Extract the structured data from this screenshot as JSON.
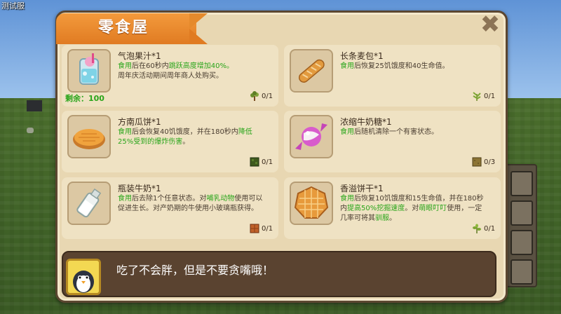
{
  "debug_label": "测试服",
  "title": "零食屋",
  "close_symbol": "✖",
  "items": [
    {
      "name": "气泡果汁*1",
      "icon": "bubble-juice-icon",
      "desc": [
        {
          "t": "食用",
          "g": true
        },
        {
          "t": "后在60秒内",
          "g": false
        },
        {
          "t": "跳跃高度增加40%。",
          "g": true
        },
        {
          "t": "周年庆活动期间周年商人处购买。",
          "g": false
        }
      ],
      "stock_label": "剩余：100",
      "cost_icon": "tree-sapling-icon",
      "cost": "0/1"
    },
    {
      "name": "长条麦包*1",
      "icon": "baguette-icon",
      "desc": [
        {
          "t": "食用",
          "g": true
        },
        {
          "t": "后恢复25饥饿度和40生命值。",
          "g": false
        }
      ],
      "stock_label": "",
      "cost_icon": "leafy-plant-icon",
      "cost": "0/1"
    },
    {
      "name": "方南瓜饼*1",
      "icon": "pumpkin-pie-icon",
      "desc": [
        {
          "t": "食用",
          "g": true
        },
        {
          "t": "后会恢复40饥饿度，并在180秒内",
          "g": false
        },
        {
          "t": "降低25%受到的爆炸伤害",
          "g": true
        },
        {
          "t": "。",
          "g": false
        }
      ],
      "stock_label": "",
      "cost_icon": "dark-grass-block-icon",
      "cost": "0/1"
    },
    {
      "name": "浓缩牛奶糖*1",
      "icon": "milk-candy-icon",
      "desc": [
        {
          "t": "食用",
          "g": true
        },
        {
          "t": "后随机清除一个有害状态。",
          "g": false
        }
      ],
      "stock_label": "",
      "cost_icon": "dirt-block-icon",
      "cost": "0/3"
    },
    {
      "name": "瓶装牛奶*1",
      "icon": "milk-bottle-icon",
      "desc": [
        {
          "t": "食用",
          "g": true
        },
        {
          "t": "后去除1个任意状态。对",
          "g": false
        },
        {
          "t": "哺乳动物",
          "g": true
        },
        {
          "t": "使用可以促进生长。对产奶期的牛使用小玻璃瓶获得。",
          "g": false
        }
      ],
      "stock_label": "",
      "cost_icon": "crate-block-icon",
      "cost": "0/1"
    },
    {
      "name": "香溢饼干*1",
      "icon": "waffle-cookie-icon",
      "desc": [
        {
          "t": "食用",
          "g": true
        },
        {
          "t": "后恢复10饥饿度和15生命值，并在180秒内",
          "g": false
        },
        {
          "t": "提高50%挖掘速度",
          "g": true
        },
        {
          "t": "。对",
          "g": false
        },
        {
          "t": "萌眼叮叮",
          "g": true
        },
        {
          "t": "使用，一定几率可将其",
          "g": false
        },
        {
          "t": "驯服",
          "g": true
        },
        {
          "t": "。",
          "g": false
        }
      ],
      "stock_label": "",
      "cost_icon": "herb-sprig-icon",
      "cost": "0/1"
    }
  ],
  "dialogue": {
    "speaker_icon": "penguin-avatar-icon",
    "text": "吃了不会胖，但是不要贪嘴哦！"
  }
}
